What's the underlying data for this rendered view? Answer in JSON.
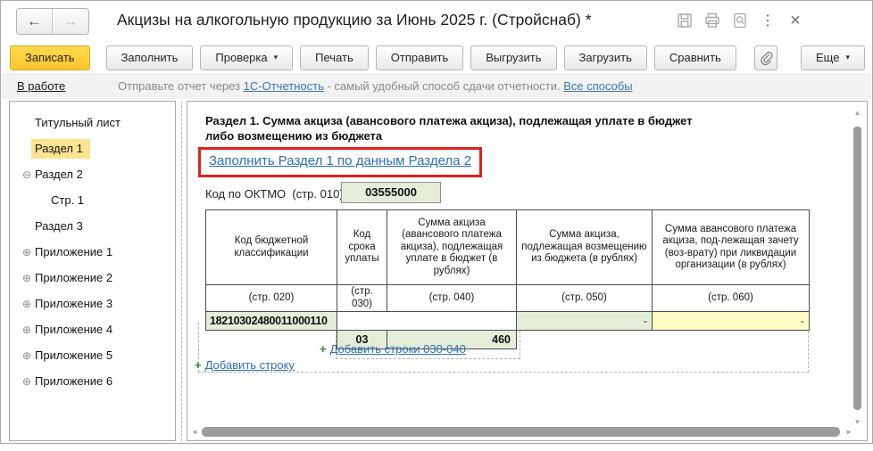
{
  "window": {
    "title": "Акцизы на алкогольную продукцию за Июнь 2025 г. (Стройснаб) *"
  },
  "icons": {
    "back": "←",
    "forward": "→",
    "kebab": "⋮",
    "close": "×",
    "dropdown": "▾",
    "expander_open": "⊖",
    "expander_closed": "⊕",
    "plus": "+",
    "scroll_up": "▲",
    "scroll_down": "▼",
    "scroll_left": "◄",
    "scroll_right": "►"
  },
  "colors": {
    "accent_yellow": "#fcc62b",
    "selected_yellow": "#fbe38f",
    "highlight_red": "#e2211c",
    "link_blue": "#2d70b8",
    "cell_green": "#e4edd8",
    "cell_yellow": "#fdfdc3"
  },
  "toolbar": {
    "save": "Записать",
    "buttons": [
      {
        "label": "Заполнить",
        "dropdown": false
      },
      {
        "label": "Проверка",
        "dropdown": true
      },
      {
        "label": "Печать",
        "dropdown": false
      },
      {
        "label": "Отправить",
        "dropdown": false
      },
      {
        "label": "Выгрузить",
        "dropdown": false
      },
      {
        "label": "Загрузить",
        "dropdown": false
      },
      {
        "label": "Сравнить",
        "dropdown": false
      }
    ],
    "more": "Еще"
  },
  "statusbar": {
    "state": "В работе",
    "text_before": "Отправьте отчет через ",
    "link_service": "1С-Отчетность",
    "text_middle": " - самый удобный способ сдачи отчетности. ",
    "link_all": "Все способы"
  },
  "sidebar": {
    "items": [
      {
        "label": "Титульный лист"
      },
      {
        "label": "Раздел 1",
        "selected": true
      },
      {
        "label": "Раздел 2",
        "expander": "open"
      },
      {
        "label": "Стр. 1",
        "indent": true
      },
      {
        "label": "Раздел 3"
      },
      {
        "label": "Приложение 1",
        "expander": "closed"
      },
      {
        "label": "Приложение 2",
        "expander": "closed"
      },
      {
        "label": "Приложение 3",
        "expander": "closed"
      },
      {
        "label": "Приложение 4",
        "expander": "closed"
      },
      {
        "label": "Приложение 5",
        "expander": "closed"
      },
      {
        "label": "Приложение 6",
        "expander": "closed"
      }
    ]
  },
  "main": {
    "section_title_line1": "Раздел 1. Сумма акциза (авансового платежа акциза), подлежащая уплате в бюджет",
    "section_title_line2": "либо возмещению из бюджета",
    "fill_link": "Заполнить Раздел 1 по данным Раздела 2",
    "oktmo_label": "Код по ОКТМО  (стр. 010)",
    "oktmo_value": "03555000",
    "table": {
      "col_titles": [
        "Код бюджетной классификации",
        "Код срока уплаты",
        "Сумма акциза (авансового платежа акциза), подлежащая уплате в бюджет (в рублях)",
        "Сумма акциза, подлежащая возмещению из бюджета (в рублях)",
        "Сумма авансового платежа акциза, под-лежащая зачету (воз-врату) при ликвидации организации (в рублях)"
      ],
      "col_subs": [
        "(стр. 020)",
        "(стр. 030)",
        "(стр. 040)",
        "(стр. 050)",
        "(стр. 060)"
      ],
      "kbk_value": "18210302480011000110",
      "refund_value": "-",
      "offset_value": "-",
      "term_code": "03",
      "amount": "460",
      "add_rows_link": "Добавить строки 030-040",
      "add_row_link": "Добавить строку"
    }
  }
}
